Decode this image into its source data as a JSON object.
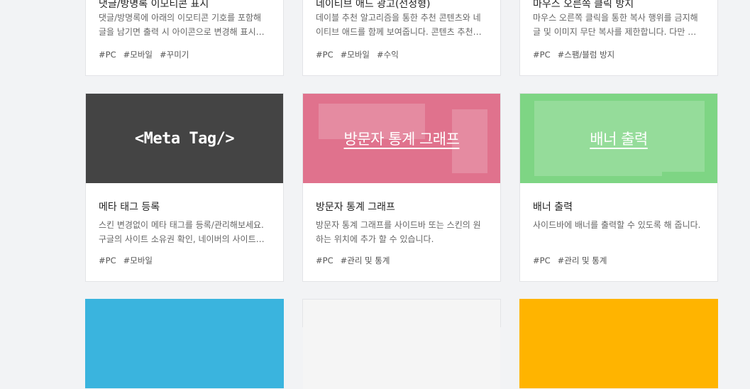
{
  "cards_row1": [
    {
      "title": "댓글/방명록 이모티콘 표시",
      "desc_lines": [
        "댓글/방명록에 아래의 이모티콘 기호를 포함해",
        "글을 남기면 출력 시 아이콘으로 변경해 표시…"
      ],
      "tags": [
        "#PC",
        "#모바일",
        "#꾸미기"
      ]
    },
    {
      "title": "네이티브 애드 광고(선정형)",
      "desc_lines": [
        "데이블 추천 알고리즘을 통한 추천 콘텐츠와 네",
        "이티브 애드를 함께 보여줍니다. 콘텐츠 추천…"
      ],
      "tags": [
        "#PC",
        "#모바일",
        "#수익"
      ]
    },
    {
      "title": "마우스 오른쪽 클릭 방지",
      "desc_lines": [
        "마우스 오른쪽 클릭을 통한 복사 행위를 금지해",
        "글 및 이미지 무단 복사를 제한합니다. 다만 …"
      ],
      "tags": [
        "#PC",
        "#스팸/블럼 방지"
      ]
    }
  ],
  "cards_row2": [
    {
      "thumb_caption": "<Meta Tag/>",
      "thumb_color": "#444444",
      "title": "메타 태그 등록",
      "desc_lines": [
        "스킨 변경없이 메타 태그를 등록/관리해보세요.",
        "구글의 사이트 소유권 확인, 네이버의 사이트…"
      ],
      "tags": [
        "#PC",
        "#모바일"
      ]
    },
    {
      "thumb_caption": "방문자 통계 그래프",
      "thumb_color": "#e0728d",
      "title": "방문자 통계 그래프",
      "desc_lines": [
        "방문자 통계 그래프를 사이드바 또는 스킨의 원",
        "하는 위치에 추가 할 수 있습니다."
      ],
      "tags": [
        "#PC",
        "#관리 및 통계"
      ]
    },
    {
      "thumb_caption": "배너 출력",
      "thumb_color": "#7ed584",
      "title": "배너 출력",
      "desc_lines": [
        "사이드바에 배너를 출력할 수 있도록 해 줍니다."
      ],
      "tags": [
        "#PC",
        "#관리 및 통계"
      ]
    }
  ],
  "cards_row3_colors": [
    "#3ab4de",
    "#f5f5f5",
    "#ffb400"
  ]
}
